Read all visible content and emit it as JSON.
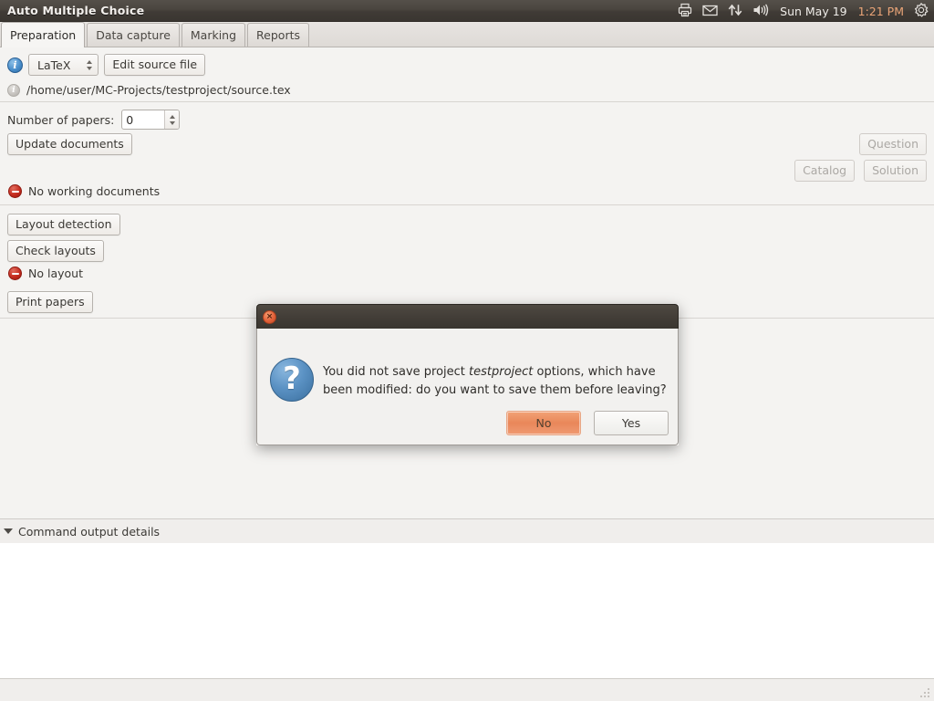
{
  "window": {
    "title": "Auto Multiple Choice"
  },
  "tray": {
    "icons": [
      "printer-icon",
      "mail-icon",
      "network-icon",
      "volume-icon",
      "power-gear-icon"
    ],
    "date": "Sun May 19",
    "time": "1:21 PM"
  },
  "tabs": [
    {
      "label": "Preparation",
      "active": true
    },
    {
      "label": "Data capture",
      "active": false
    },
    {
      "label": "Marking",
      "active": false
    },
    {
      "label": "Reports",
      "active": false
    }
  ],
  "preparation": {
    "source_format": "LaTeX",
    "edit_source_label": "Edit source file",
    "source_path": "/home/user/MC-Projects/testproject/source.tex",
    "papers_label": "Number of papers:",
    "papers_value": "0",
    "update_documents_label": "Update documents",
    "question_label": "Question",
    "catalog_label": "Catalog",
    "solution_label": "Solution",
    "working_documents_status": "No working documents",
    "layout_detection_label": "Layout detection",
    "check_layouts_label": "Check layouts",
    "layout_status": "No layout",
    "print_papers_label": "Print papers"
  },
  "command_output": {
    "label": "Command output details",
    "expander": "triangle-down-icon"
  },
  "dialog": {
    "close_glyph": "×",
    "icon": "question-icon",
    "message_part1": "You did not save project ",
    "message_italic": "testproject",
    "message_part2": " options, which have been modified: do you want to save them before leaving?",
    "no_label": "No",
    "yes_label": "Yes"
  },
  "colors": {
    "titlebar": "#433e38",
    "panel": "#f4f3f1",
    "accent_orange": "#e9875a",
    "status_red": "#c62d20",
    "info_blue": "#4a8fcb",
    "time_text": "#e9a477"
  }
}
